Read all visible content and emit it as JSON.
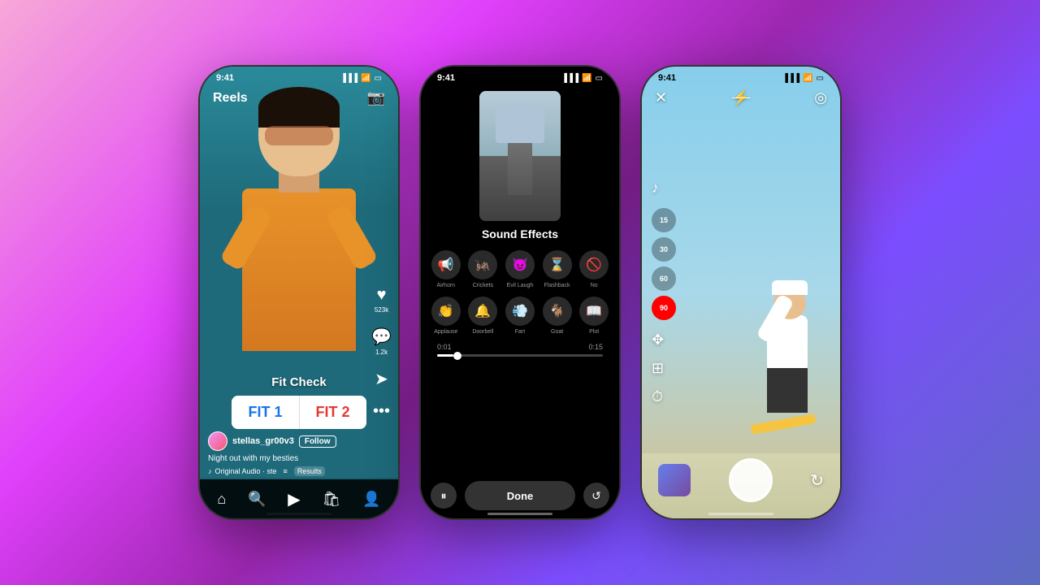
{
  "background": {
    "gradient_start": "#ff9ebb",
    "gradient_end": "#667eea"
  },
  "phone1": {
    "status_time": "9:41",
    "title": "Reels",
    "camera_icon": "⊙",
    "fit_check_title": "Fit Check",
    "fit1_label": "FIT 1",
    "fit2_label": "FIT 2",
    "heart_icon": "♥",
    "like_count": "523k",
    "comment_icon": "💬",
    "comment_count": "1.2k",
    "share_icon": "➤",
    "username": "stellas_gr00v3",
    "follow_label": "Follow",
    "caption": "Night out with my besties",
    "audio_icon": "♪",
    "audio_text": "Original Audio · ste",
    "results_label": "Results",
    "nav_home": "⌂",
    "nav_search": "🔍",
    "nav_reel": "⬛",
    "nav_shop": "🛍",
    "nav_profile": "👤"
  },
  "phone2": {
    "status_time": "9:41",
    "title": "Sound Effects",
    "sounds_row1": [
      {
        "icon": "📢",
        "label": "Airhorn"
      },
      {
        "icon": "🦗",
        "label": "Crickets"
      },
      {
        "icon": "😈",
        "label": "Evil Laugh"
      },
      {
        "icon": "⌛",
        "label": "Flashback"
      },
      {
        "icon": "🚫",
        "label": "No"
      }
    ],
    "sounds_row2": [
      {
        "icon": "👏",
        "label": "Applause"
      },
      {
        "icon": "🔔",
        "label": "Doorbell"
      },
      {
        "icon": "💨",
        "label": "Fart"
      },
      {
        "icon": "🐐",
        "label": "Goat"
      },
      {
        "icon": "📖",
        "label": "Plot"
      }
    ],
    "time_start": "0:01",
    "time_end": "0:15",
    "pause_icon": "⏸",
    "done_label": "Done",
    "reset_icon": "↺"
  },
  "phone3": {
    "status_time": "9:41",
    "close_icon": "✕",
    "settings_icon": "◎",
    "flash_icon": "⚡",
    "music_icon": "♪",
    "duration_options": [
      "15",
      "30",
      "60",
      "90"
    ],
    "active_duration": "90",
    "move_icon": "✥",
    "layout_icon": "⊞",
    "timer_icon": "⏱",
    "flip_icon": "↻"
  }
}
